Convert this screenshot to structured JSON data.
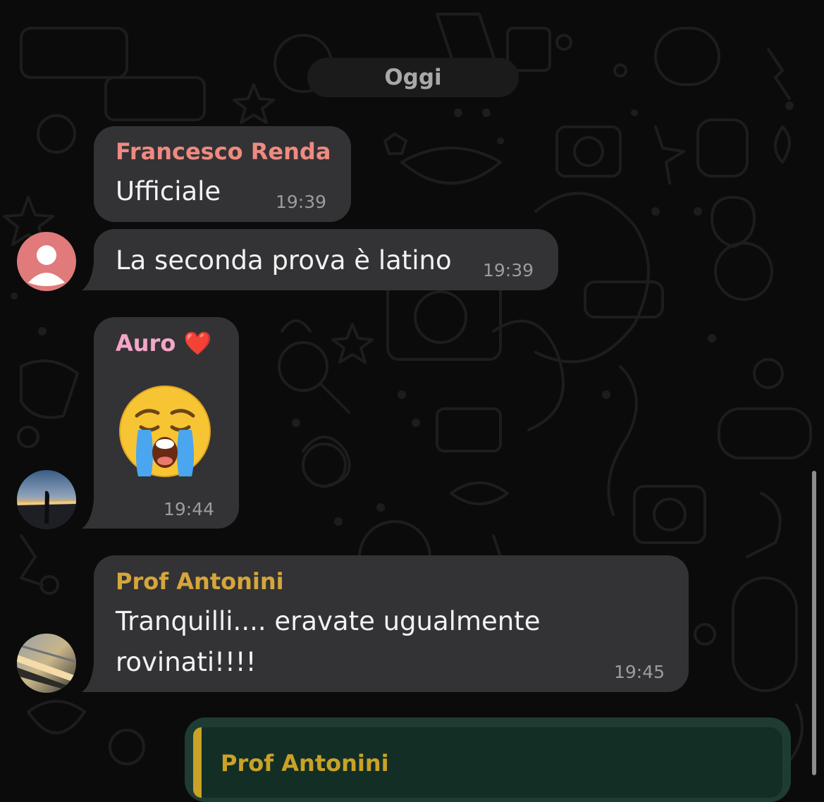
{
  "chat": {
    "date_separator": "Oggi",
    "messages": [
      {
        "sender": "Francesco Renda",
        "sender_color": "#ef8a80",
        "text": "Ufficiale",
        "time": "19:39"
      },
      {
        "text": "La seconda prova è latino",
        "time": "19:39",
        "avatar": "default-user-avatar"
      },
      {
        "sender": "Auro ❤️",
        "sender_color": "#f4a6c9",
        "emoji": "😭",
        "time": "19:44",
        "avatar": "sunset-photo-avatar"
      },
      {
        "sender": "Prof Antonini",
        "sender_color": "#d6a63a",
        "text_line1": "Tranquilli.... eravate ugualmente",
        "text_line2": "rovinati!!!!",
        "time": "19:45",
        "avatar": "sea-photo-avatar"
      }
    ],
    "outgoing_reply": {
      "quoted_sender": "Prof Antonini",
      "quoted_sender_color": "#c9a227"
    }
  },
  "colors": {
    "background": "#0b0b0b",
    "bubble_incoming": "#333336",
    "bubble_outgoing": "#1f3c33",
    "timestamp": "#9c9c9c"
  }
}
